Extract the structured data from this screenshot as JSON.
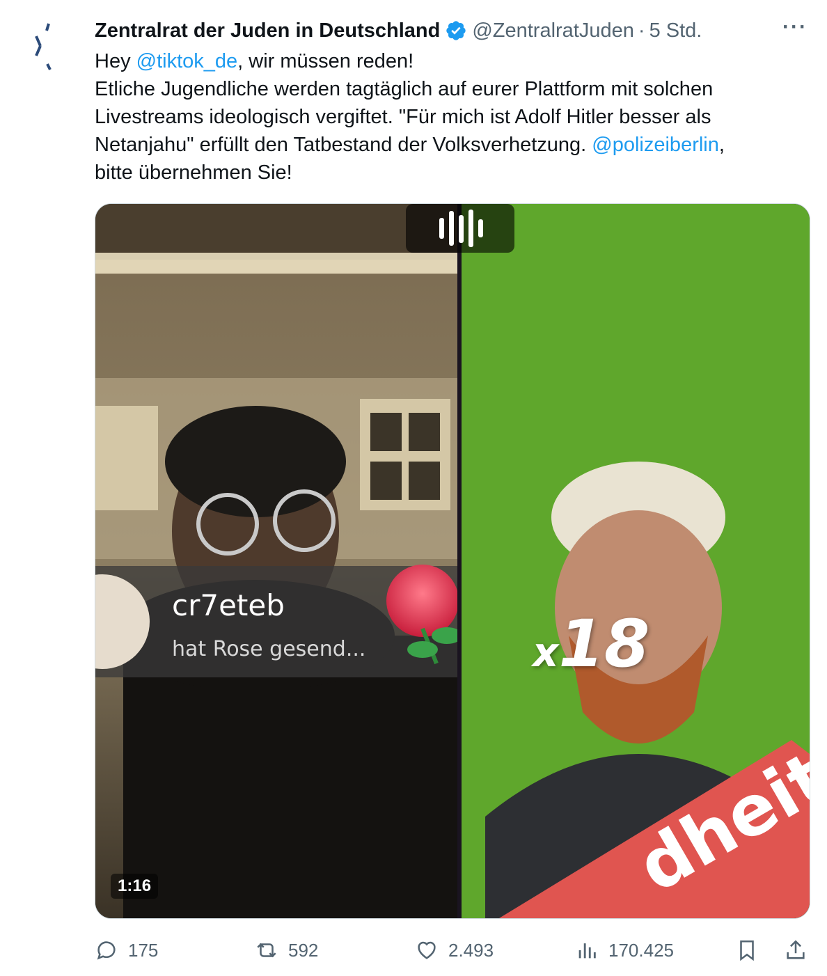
{
  "tweet": {
    "author_name": "Zentralrat der Juden in Deutschland",
    "handle": "@ZentralratJuden",
    "separator": "·",
    "time": "5 Std.",
    "more": "···",
    "lines": [
      [
        {
          "t": "Hey ",
          "m": false
        },
        {
          "t": "@tiktok_de",
          "m": true
        },
        {
          "t": ", wir müssen reden!",
          "m": false
        }
      ],
      [
        {
          "t": "Etliche Jugendliche werden tagtäglich auf eurer Plattform mit solchen",
          "m": false
        }
      ],
      [
        {
          "t": "Livestreams ideologisch vergiftet. \"Für mich ist Adolf Hitler besser als",
          "m": false
        }
      ],
      [
        {
          "t": "Netanjahu\" erfüllt den Tatbestand der Volksverhetzung. ",
          "m": false
        },
        {
          "t": "@polizeiberlin",
          "m": true
        },
        {
          "t": ",",
          "m": false
        }
      ],
      [
        {
          "t": "bitte übernehmen Sie!",
          "m": false
        }
      ]
    ]
  },
  "media": {
    "duration": "1:16",
    "gift_user": "cr7eteb",
    "gift_action": "hat Rose  gesend...",
    "multiplier_x": "x",
    "multiplier_n": "18",
    "sticker_text": "dheit"
  },
  "actions": {
    "replies": "175",
    "reposts": "592",
    "likes": "2.493",
    "views": "170.425"
  },
  "colors": {
    "accent": "#1d9bf0",
    "muted": "#536471",
    "green_screen": "#5fa72c",
    "sticker_red": "#e05550"
  },
  "icons": [
    "verified-badge-icon",
    "more-icon",
    "reply-icon",
    "repost-icon",
    "like-icon",
    "views-icon",
    "bookmark-icon",
    "share-icon"
  ]
}
